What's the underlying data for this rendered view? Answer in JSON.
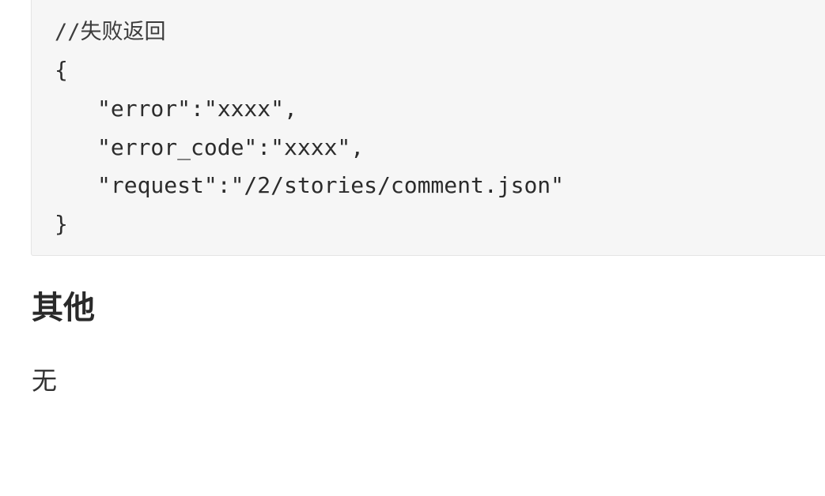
{
  "code_block": {
    "lines": [
      "//失败返回",
      "{",
      "\"error\":\"xxxx\",",
      "\"error_code\":\"xxxx\",",
      "\"request\":\"/2/stories/comment.json\"",
      "}"
    ]
  },
  "section": {
    "heading": "其他",
    "body": "无"
  }
}
